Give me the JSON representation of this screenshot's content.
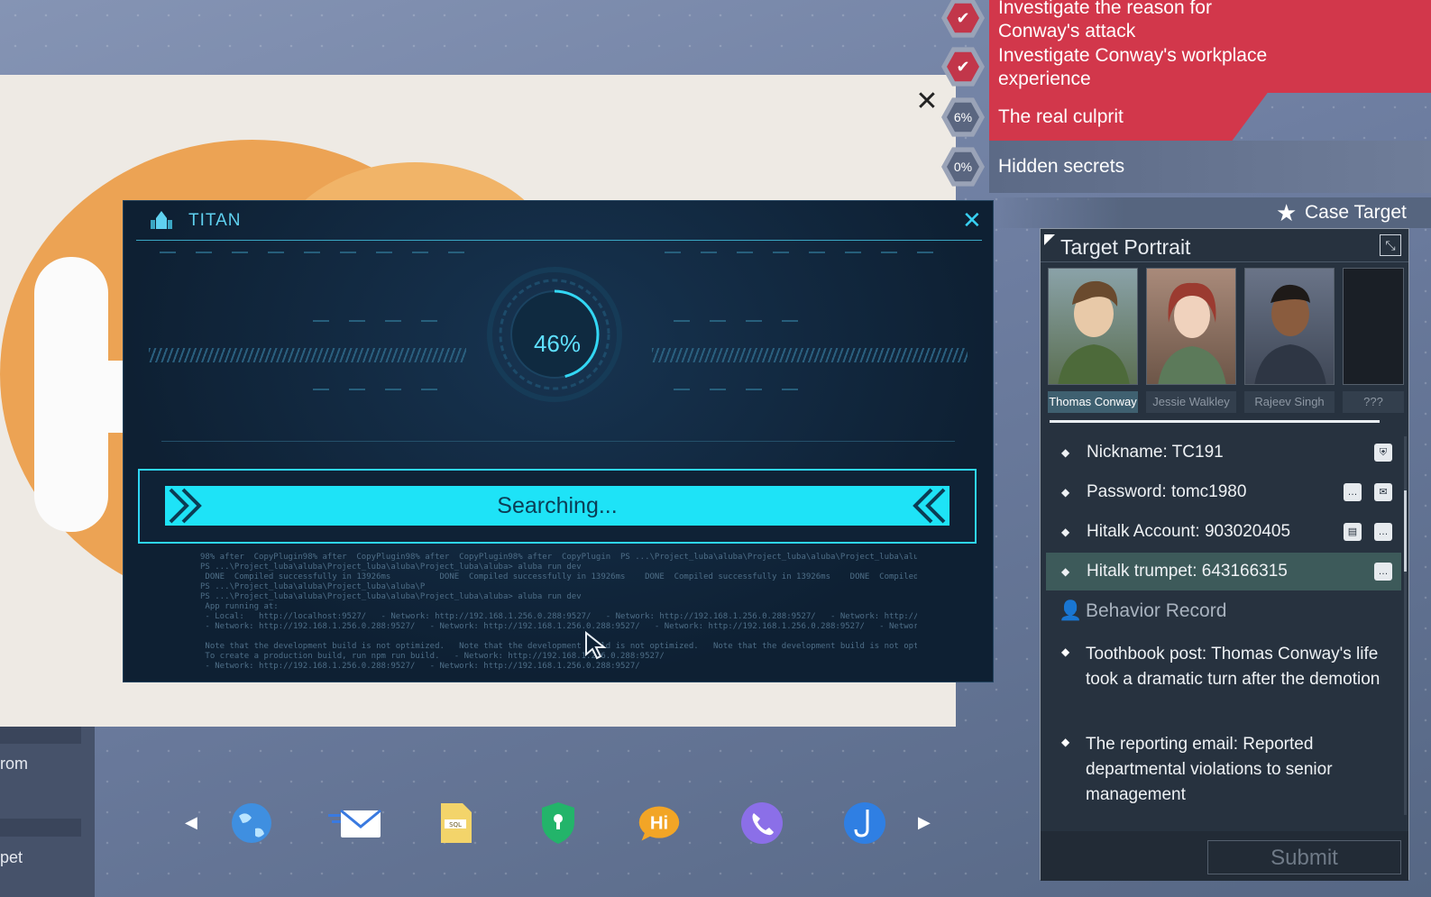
{
  "objectives": [
    {
      "text": "Investigate the reason for Conway's attack",
      "state": "done"
    },
    {
      "text": "Investigate Conway's workplace experience",
      "state": "done"
    },
    {
      "text": "The real culprit",
      "progress_label": "6%"
    },
    {
      "text": "Hidden secrets",
      "progress_label": "0%"
    }
  ],
  "titan": {
    "app_name": "TITAN",
    "progress_label": "46%",
    "progress": 0.46,
    "status": "Searching...",
    "log": "98% after  CopyPlugin98% after  CopyPlugin98% after  CopyPlugin98% after  CopyPlugin  PS ...\\Project_luba\\aluba\\Project_luba\\aluba\\Project_luba\\aluba\\P\nPS ...\\Project_luba\\aluba\\Project_luba\\aluba\\Project_luba\\aluba> aluba run dev\n DONE  Compiled successfully in 13926ms          DONE  Compiled successfully in 13926ms    DONE  Compiled successfully in 13926ms    DONE  Compiled successful\nPS ...\\Project_luba\\aluba\\Project_luba\\aluba\\P\nPS ...\\Project_luba\\aluba\\Project_luba\\aluba\\Project_luba\\aluba> aluba run dev\n App running at:\n - Local:   http://localhost:9527/   - Network: http://192.168.1.256.0.288:9527/   - Network: http://192.168.1.256.0.288:9527/   - Network: http://192.168.1.256.0.288:9527/\n - Network: http://192.168.1.256.0.288:9527/   - Network: http://192.168.1.256.0.288:9527/   - Network: http://192.168.1.256.0.288:9527/   - Network: http://192.168.1.256.0.\n\n Note that the development build is not optimized.   Note that the development build is not optimized.   Note that the development build is not optimized.   Note that the devel\n To create a production build, run npm run build.   - Network: http://192.168.1.256.0.288:9527/\n - Network: http://192.168.1.256.0.288:9527/   - Network: http://192.168.1.256.0.288:9527/"
  },
  "left_sidebar": {
    "item1": "rom",
    "item2": "pet"
  },
  "dock": [
    {
      "icon": "globe-icon"
    },
    {
      "icon": "mail-icon"
    },
    {
      "icon": "sql-file-icon"
    },
    {
      "icon": "shield-lock-icon"
    },
    {
      "icon": "hitalk-icon",
      "label": "Hi"
    },
    {
      "icon": "phone-icon"
    },
    {
      "icon": "hook-icon"
    }
  ],
  "case_target": {
    "label": "Case Target"
  },
  "target_portrait": {
    "title": "Target Portrait",
    "portraits": [
      {
        "name": "Thomas Conway",
        "selected": true
      },
      {
        "name": "Jessie Walkley"
      },
      {
        "name": "Rajeev Singh"
      },
      {
        "name": "???"
      }
    ],
    "info": [
      {
        "text": "Nickname: TC191",
        "icons": [
          "shield-icon"
        ]
      },
      {
        "text": "Password: tomc1980",
        "icons": [
          "chat-icon",
          "mail-icon"
        ]
      },
      {
        "text": "Hitalk Account: 903020405",
        "icons": [
          "document-icon",
          "chat-icon"
        ]
      },
      {
        "text": "Hitalk trumpet: 643166315",
        "icons": [
          "chat-icon"
        ],
        "highlighted": true
      }
    ],
    "behavior_title": "Behavior Record",
    "behavior": [
      "Toothbook post: Thomas Conway's life took a dramatic turn after the demotion",
      "The reporting email: Reported departmental violations to senior management"
    ],
    "submit_label": "Submit"
  },
  "colors": {
    "accent_cyan": "#1ee3f7",
    "objective_red": "#d2374b",
    "panel_bg": "#27323f"
  }
}
